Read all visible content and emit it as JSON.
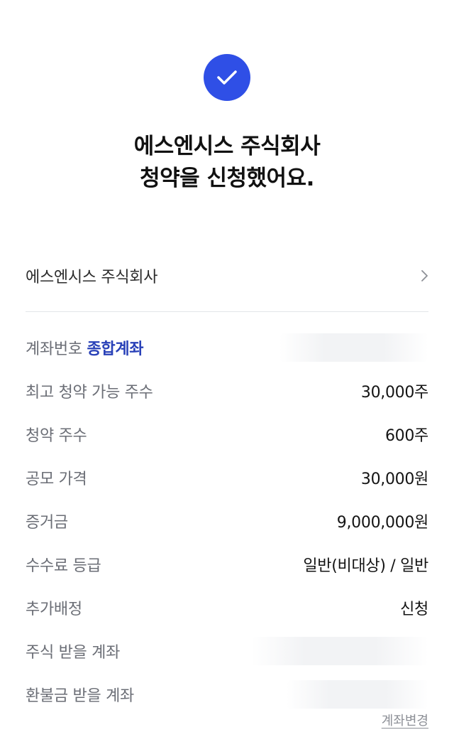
{
  "header": {
    "icon": "check-icon",
    "accent_color": "#2f4fe6",
    "title_line1": "에스엔시스 주식회사",
    "title_line2": "청약을 신청했어요."
  },
  "company": {
    "name": "에스엔시스 주식회사",
    "icon": "chevron-right-icon"
  },
  "details": {
    "account": {
      "label": "계좌번호",
      "type": "종합계좌",
      "value": ""
    },
    "max_shares": {
      "label": "최고 청약 가능 주수",
      "value": "30,000주"
    },
    "subscribed_shares": {
      "label": "청약 주수",
      "value": "600주"
    },
    "offer_price": {
      "label": "공모 가격",
      "value": "30,000원"
    },
    "deposit": {
      "label": "증거금",
      "value": "9,000,000원"
    },
    "fee_grade": {
      "label": "수수료 등급",
      "value": "일반(비대상) / 일반"
    },
    "extra_allocation": {
      "label": "추가배정",
      "value": "신청"
    },
    "stock_account": {
      "label": "주식 받을 계좌",
      "value": ""
    },
    "refund_account": {
      "label": "환불금 받을 계좌",
      "value": ""
    }
  },
  "actions": {
    "change_account_label": "계좌변경"
  }
}
